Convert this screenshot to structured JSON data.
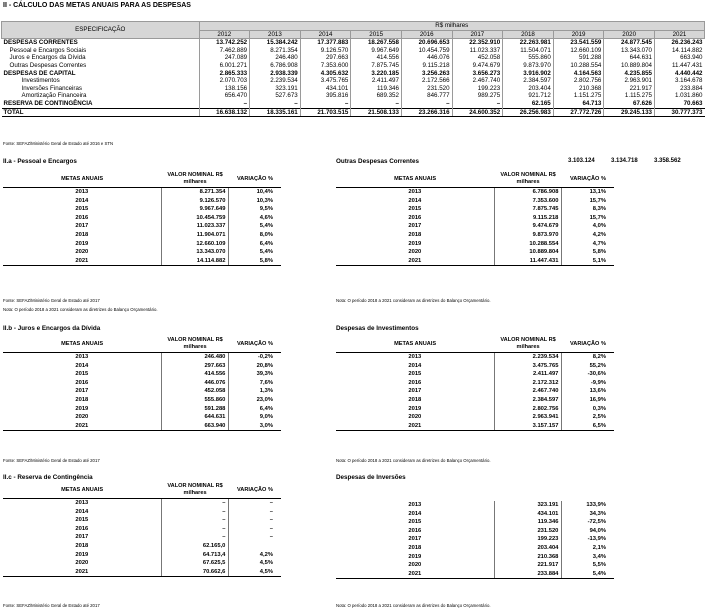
{
  "title": "II - CÁLCULO DAS METAS ANUAIS PARA AS DESPESAS",
  "main_table": {
    "spec_header": "ESPECIFICAÇÃO",
    "unit_header": "R$ milhares",
    "years": [
      "2012",
      "2013",
      "2014",
      "2015",
      "2016",
      "2017",
      "2018",
      "2019",
      "2020",
      "2021"
    ],
    "rows": [
      {
        "label": "DESPESAS CORRENTES",
        "style": "bold",
        "values": [
          "13.742.252",
          "15.384.242",
          "17.377.883",
          "18.267.558",
          "20.696.653",
          "22.352.910",
          "22.263.981",
          "23.541.559",
          "24.877.545",
          "26.236.243"
        ]
      },
      {
        "label": "Pessoal e Encargos Sociais",
        "style": "ind1",
        "values": [
          "7.462.889",
          "8.271.354",
          "9.126.570",
          "9.967.649",
          "10.454.759",
          "11.023.337",
          "11.504.071",
          "12.660.109",
          "13.343.070",
          "14.114.882"
        ]
      },
      {
        "label": "Juros e Encargos da Dívida",
        "style": "ind1",
        "values": [
          "247.089",
          "246.480",
          "297.663",
          "414.556",
          "446.076",
          "452.058",
          "555.860",
          "591.288",
          "644.631",
          "663.940"
        ]
      },
      {
        "label": "Outras Despesas Correntes",
        "style": "ind1",
        "values": [
          "6.001.271",
          "6.786.908",
          "7.353.600",
          "7.875.745",
          "9.115.218",
          "9.474.679",
          "9.873.970",
          "10.288.554",
          "10.889.804",
          "11.447.431"
        ]
      },
      {
        "label": "DESPESAS DE CAPITAL",
        "style": "bold",
        "values": [
          "2.865.333",
          "2.938.339",
          "4.305.632",
          "3.220.185",
          "3.256.263",
          "3.656.273",
          "3.916.902",
          "4.164.563",
          "4.235.855",
          "4.440.442"
        ]
      },
      {
        "label": "Investimentos",
        "style": "ind2",
        "values": [
          "2.070.703",
          "2.239.534",
          "3.475.765",
          "2.411.497",
          "2.172.566",
          "2.467.740",
          "2.384.597",
          "2.802.756",
          "2.963.901",
          "3.164.678"
        ]
      },
      {
        "label": "Inversões Financeiras",
        "style": "ind2",
        "values": [
          "138.156",
          "323.191",
          "434.101",
          "119.346",
          "231.520",
          "199.223",
          "203.404",
          "210.368",
          "221.917",
          "233.884"
        ]
      },
      {
        "label": "Amortização Financeira",
        "style": "ind2",
        "values": [
          "656.470",
          "527.673",
          "395.816",
          "689.352",
          "846.777",
          "989.275",
          "921.712",
          "1.151.275",
          "1.115.275",
          "1.031.860"
        ]
      },
      {
        "label": "RESERVA DE CONTINGÊNCIA",
        "style": "bold",
        "values": [
          "–",
          "–",
          "–",
          "–",
          "–",
          "–",
          "62.165",
          "64.713",
          "67.626",
          "70.663"
        ]
      },
      {
        "label": "TOTAL",
        "style": "total",
        "values": [
          "16.638.132",
          "18.335.161",
          "21.703.515",
          "21.508.133",
          "23.266.316",
          "24.600.352",
          "26.256.983",
          "27.772.726",
          "29.245.133",
          "30.777.373"
        ]
      }
    ],
    "source": "Fonte: SEFAZ/Ministério Geral de Estado até 2016 e STN"
  },
  "sections": {
    "pessoal": {
      "title": "II.a - Pessoal e Encargos",
      "col_year": "METAS ANUAIS",
      "col_value": "VALOR NOMINAL R$ milhares",
      "col_pct": "VARIAÇÃO %",
      "rows": [
        {
          "year": "2013",
          "value": "8.271.354",
          "pct": "10,4%"
        },
        {
          "year": "2014",
          "value": "9.126.570",
          "pct": "10,3%"
        },
        {
          "year": "2015",
          "value": "9.967.649",
          "pct": "9,5%"
        },
        {
          "year": "2016",
          "value": "10.454.759",
          "pct": "4,6%"
        },
        {
          "year": "2017",
          "value": "11.023.337",
          "pct": "5,4%"
        },
        {
          "year": "2018",
          "value": "11.904.071",
          "pct": "8,0%"
        },
        {
          "year": "2019",
          "value": "12.660.109",
          "pct": "6,4%"
        },
        {
          "year": "2020",
          "value": "13.343.070",
          "pct": "5,4%"
        },
        {
          "year": "2021",
          "value": "14.114.882",
          "pct": "5,8%"
        }
      ],
      "source": "Fonte: SEFAZ/Ministério Geral de Estado até 2017",
      "note": "Nota: O período 2018 a 2021 consideram as diretrizes do Balanço Orçamentário."
    },
    "outras": {
      "title": "Outras Despesas Correntes",
      "extra": [
        "3.103.124",
        "3.134.718",
        "3.358.562"
      ],
      "col_year": "METAS ANUAIS",
      "col_value": "VALOR NOMINAL R$ milhares",
      "col_pct": "VARIAÇÃO %",
      "rows": [
        {
          "year": "2013",
          "value": "6.786.908",
          "pct": "13,1%"
        },
        {
          "year": "2014",
          "value": "7.353.600",
          "pct": "15,7%"
        },
        {
          "year": "2015",
          "value": "7.875.745",
          "pct": "8,3%"
        },
        {
          "year": "2016",
          "value": "9.115.218",
          "pct": "15,7%"
        },
        {
          "year": "2017",
          "value": "9.474.679",
          "pct": "4,0%"
        },
        {
          "year": "2018",
          "value": "9.873.970",
          "pct": "4,2%"
        },
        {
          "year": "2019",
          "value": "10.288.554",
          "pct": "4,7%"
        },
        {
          "year": "2020",
          "value": "10.889.804",
          "pct": "5,8%"
        },
        {
          "year": "2021",
          "value": "11.447.431",
          "pct": "5,1%"
        }
      ],
      "note": "Nota: O período 2018 a 2021 consideram as diretrizes do Balanço Orçamentário."
    },
    "juros": {
      "title": "II.b - Juros e Encargos da Dívida",
      "col_year": "METAS ANUAIS",
      "col_value": "VALOR NOMINAL R$ milhares",
      "col_pct": "VARIAÇÃO %",
      "rows": [
        {
          "year": "2013",
          "value": "246.480",
          "pct": "-0,2%"
        },
        {
          "year": "2014",
          "value": "297.663",
          "pct": "20,8%"
        },
        {
          "year": "2015",
          "value": "414.556",
          "pct": "39,3%"
        },
        {
          "year": "2016",
          "value": "446.076",
          "pct": "7,6%"
        },
        {
          "year": "2017",
          "value": "452.058",
          "pct": "1,3%"
        },
        {
          "year": "2018",
          "value": "555.860",
          "pct": "23,0%"
        },
        {
          "year": "2019",
          "value": "591.288",
          "pct": "6,4%"
        },
        {
          "year": "2020",
          "value": "644.631",
          "pct": "9,0%"
        },
        {
          "year": "2021",
          "value": "663.940",
          "pct": "3,0%"
        }
      ],
      "source": "Fonte: SEFAZ/Ministério Geral de Estado até 2017"
    },
    "investimentos": {
      "title": "Despesas de Investimentos",
      "col_year": "METAS ANUAIS",
      "col_value": "VALOR NOMINAL R$ milhares",
      "col_pct": "VARIAÇÃO %",
      "rows": [
        {
          "year": "2013",
          "value": "2.239.534",
          "pct": "8,2%"
        },
        {
          "year": "2014",
          "value": "3.475.765",
          "pct": "55,2%"
        },
        {
          "year": "2015",
          "value": "2.411.497",
          "pct": "-30,6%"
        },
        {
          "year": "2016",
          "value": "2.172.312",
          "pct": "-9,9%"
        },
        {
          "year": "2017",
          "value": "2.467.740",
          "pct": "13,6%"
        },
        {
          "year": "2018",
          "value": "2.384.597",
          "pct": "16,9%"
        },
        {
          "year": "2019",
          "value": "2.802.756",
          "pct": "0,3%"
        },
        {
          "year": "2020",
          "value": "2.963.941",
          "pct": "2,5%"
        },
        {
          "year": "2021",
          "value": "3.157.157",
          "pct": "6,5%"
        }
      ],
      "note": "Nota: O período 2018 a 2021 consideram as diretrizes do Balanço Orçamentário."
    },
    "reserva": {
      "title": "II.c - Reserva de Contingência",
      "col_year": "METAS ANUAIS",
      "col_value": "VALOR NOMINAL R$ milhares",
      "col_pct": "VARIAÇÃO %",
      "rows": [
        {
          "year": "2013",
          "value": "–",
          "pct": "–"
        },
        {
          "year": "2014",
          "value": "–",
          "pct": "–"
        },
        {
          "year": "2015",
          "value": "–",
          "pct": "–"
        },
        {
          "year": "2016",
          "value": "–",
          "pct": "–"
        },
        {
          "year": "2017",
          "value": "–",
          "pct": "–"
        },
        {
          "year": "2018",
          "value": "62.165,0",
          "pct": ""
        },
        {
          "year": "2019",
          "value": "64.713,4",
          "pct": "4,2%"
        },
        {
          "year": "2020",
          "value": "67.625,5",
          "pct": "4,5%"
        },
        {
          "year": "2021",
          "value": "70.662,6",
          "pct": "4,5%"
        }
      ],
      "source": "Fonte: SEFAZ/Ministério Geral de Estado até 2017"
    },
    "inversoes": {
      "title": "Despesas de Inversões",
      "rows": [
        {
          "year": "2013",
          "value": "323.191",
          "pct": "133,9%"
        },
        {
          "year": "2014",
          "value": "434.101",
          "pct": "34,3%"
        },
        {
          "year": "2015",
          "value": "119.346",
          "pct": "-72,5%"
        },
        {
          "year": "2016",
          "value": "231.520",
          "pct": "94,0%"
        },
        {
          "year": "2017",
          "value": "199.223",
          "pct": "-13,9%"
        },
        {
          "year": "2018",
          "value": "203.404",
          "pct": "2,1%"
        },
        {
          "year": "2019",
          "value": "210.368",
          "pct": "3,4%"
        },
        {
          "year": "2020",
          "value": "221.917",
          "pct": "5,5%"
        },
        {
          "year": "2021",
          "value": "233.884",
          "pct": "5,4%"
        }
      ],
      "note": "Nota: O período 2018 a 2021 consideram as diretrizes do Balanço Orçamentário."
    }
  }
}
